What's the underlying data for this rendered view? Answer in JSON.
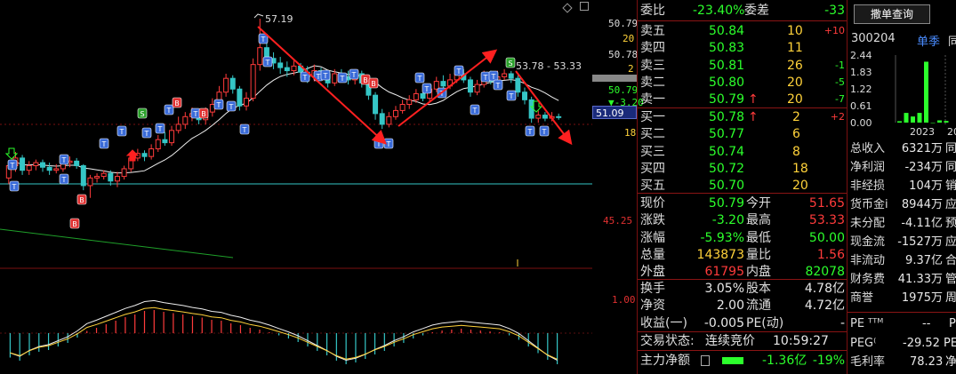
{
  "chart": {
    "high_label": "57.19",
    "range_label": "53.78 - 53.33",
    "current_price_tag": "51.09",
    "axis_labels": [
      "50.79",
      "20",
      "50.78",
      "2",
      "50.79",
      "▼-3.20",
      "20",
      "18",
      "45.25",
      "1.00"
    ],
    "marker_S": "S",
    "marker_B": "B",
    "marker_T": "T",
    "candles": [
      {
        "o": 46.8,
        "c": 47.6,
        "h": 47.9,
        "l": 46.4
      },
      {
        "o": 47.6,
        "c": 48.1,
        "h": 48.5,
        "l": 47.2
      },
      {
        "o": 48.1,
        "c": 47.3,
        "h": 48.3,
        "l": 47.0
      },
      {
        "o": 47.3,
        "c": 47.6,
        "h": 47.9,
        "l": 47.0
      },
      {
        "o": 47.6,
        "c": 47.8,
        "h": 48.0,
        "l": 47.3
      },
      {
        "o": 47.8,
        "c": 47.5,
        "h": 48.0,
        "l": 47.2
      },
      {
        "o": 47.5,
        "c": 47.3,
        "h": 47.8,
        "l": 47.0
      },
      {
        "o": 47.3,
        "c": 47.4,
        "h": 47.7,
        "l": 47.1
      },
      {
        "o": 47.4,
        "c": 47.8,
        "h": 48.1,
        "l": 47.2
      },
      {
        "o": 47.8,
        "c": 47.9,
        "h": 48.2,
        "l": 47.5
      },
      {
        "o": 47.9,
        "c": 47.6,
        "h": 48.1,
        "l": 47.4
      },
      {
        "o": 47.6,
        "c": 46.3,
        "h": 47.7,
        "l": 46.0
      },
      {
        "o": 46.3,
        "c": 46.8,
        "h": 47.0,
        "l": 45.5
      },
      {
        "o": 46.8,
        "c": 46.9,
        "h": 47.1,
        "l": 46.5
      },
      {
        "o": 46.9,
        "c": 47.1,
        "h": 47.3,
        "l": 46.7
      },
      {
        "o": 47.1,
        "c": 46.6,
        "h": 47.3,
        "l": 46.3
      },
      {
        "o": 46.6,
        "c": 46.9,
        "h": 47.2,
        "l": 46.2
      },
      {
        "o": 46.9,
        "c": 47.4,
        "h": 47.6,
        "l": 46.7
      },
      {
        "o": 47.4,
        "c": 48.1,
        "h": 48.4,
        "l": 47.2
      },
      {
        "o": 48.1,
        "c": 48.4,
        "h": 48.7,
        "l": 47.9
      },
      {
        "o": 48.4,
        "c": 48.2,
        "h": 48.6,
        "l": 47.9
      },
      {
        "o": 48.2,
        "c": 48.7,
        "h": 49.0,
        "l": 48.0
      },
      {
        "o": 48.7,
        "c": 49.3,
        "h": 49.6,
        "l": 48.5
      },
      {
        "o": 49.3,
        "c": 49.1,
        "h": 49.8,
        "l": 48.9
      },
      {
        "o": 49.1,
        "c": 49.9,
        "h": 50.2,
        "l": 48.9
      },
      {
        "o": 49.9,
        "c": 50.3,
        "h": 50.8,
        "l": 49.7
      },
      {
        "o": 50.3,
        "c": 50.8,
        "h": 51.1,
        "l": 50.0
      },
      {
        "o": 50.8,
        "c": 51.0,
        "h": 51.4,
        "l": 50.5
      },
      {
        "o": 51.0,
        "c": 50.6,
        "h": 51.2,
        "l": 50.3
      },
      {
        "o": 50.6,
        "c": 51.1,
        "h": 51.4,
        "l": 50.3
      },
      {
        "o": 51.1,
        "c": 51.6,
        "h": 52.0,
        "l": 50.8
      },
      {
        "o": 51.6,
        "c": 52.4,
        "h": 52.8,
        "l": 51.3
      },
      {
        "o": 52.4,
        "c": 53.3,
        "h": 53.6,
        "l": 52.1
      },
      {
        "o": 53.3,
        "c": 52.6,
        "h": 53.5,
        "l": 52.3
      },
      {
        "o": 52.6,
        "c": 51.5,
        "h": 52.8,
        "l": 51.2
      },
      {
        "o": 51.5,
        "c": 52.0,
        "h": 52.4,
        "l": 51.2
      },
      {
        "o": 52.0,
        "c": 54.2,
        "h": 54.6,
        "l": 51.8
      },
      {
        "o": 54.2,
        "c": 55.3,
        "h": 57.19,
        "l": 53.8
      },
      {
        "o": 55.3,
        "c": 54.6,
        "h": 55.8,
        "l": 54.3
      },
      {
        "o": 54.6,
        "c": 54.3,
        "h": 55.0,
        "l": 53.9
      },
      {
        "o": 54.3,
        "c": 54.0,
        "h": 54.7,
        "l": 53.6
      },
      {
        "o": 54.0,
        "c": 53.8,
        "h": 54.4,
        "l": 53.4
      },
      {
        "o": 53.8,
        "c": 54.1,
        "h": 54.5,
        "l": 53.5
      },
      {
        "o": 54.1,
        "c": 53.7,
        "h": 54.3,
        "l": 53.3
      },
      {
        "o": 53.7,
        "c": 53.4,
        "h": 54.1,
        "l": 53.0
      },
      {
        "o": 53.4,
        "c": 53.8,
        "h": 54.2,
        "l": 53.1
      },
      {
        "o": 53.8,
        "c": 53.6,
        "h": 54.0,
        "l": 53.2
      },
      {
        "o": 53.6,
        "c": 53.0,
        "h": 53.8,
        "l": 52.7
      },
      {
        "o": 53.0,
        "c": 53.6,
        "h": 53.9,
        "l": 52.8
      },
      {
        "o": 53.6,
        "c": 53.4,
        "h": 53.9,
        "l": 53.1
      },
      {
        "o": 53.4,
        "c": 53.2,
        "h": 53.8,
        "l": 52.9
      },
      {
        "o": 53.2,
        "c": 53.6,
        "h": 53.9,
        "l": 52.9
      },
      {
        "o": 53.6,
        "c": 53.0,
        "h": 53.8,
        "l": 52.7
      },
      {
        "o": 53.0,
        "c": 52.2,
        "h": 53.2,
        "l": 51.9
      },
      {
        "o": 52.2,
        "c": 51.0,
        "h": 52.4,
        "l": 50.6
      },
      {
        "o": 51.0,
        "c": 50.3,
        "h": 51.3,
        "l": 50.0
      },
      {
        "o": 50.3,
        "c": 50.8,
        "h": 51.1,
        "l": 50.1
      },
      {
        "o": 50.8,
        "c": 51.2,
        "h": 51.5,
        "l": 50.6
      },
      {
        "o": 51.2,
        "c": 51.6,
        "h": 51.9,
        "l": 51.0
      },
      {
        "o": 51.6,
        "c": 51.9,
        "h": 52.2,
        "l": 51.3
      },
      {
        "o": 51.9,
        "c": 52.3,
        "h": 52.6,
        "l": 51.7
      },
      {
        "o": 52.3,
        "c": 52.0,
        "h": 52.7,
        "l": 51.8
      },
      {
        "o": 52.0,
        "c": 52.6,
        "h": 52.9,
        "l": 51.8
      },
      {
        "o": 52.6,
        "c": 53.1,
        "h": 53.4,
        "l": 52.4
      },
      {
        "o": 53.1,
        "c": 52.8,
        "h": 53.5,
        "l": 52.5
      },
      {
        "o": 52.8,
        "c": 53.2,
        "h": 53.6,
        "l": 52.6
      },
      {
        "o": 53.2,
        "c": 53.6,
        "h": 53.9,
        "l": 53.0
      },
      {
        "o": 53.6,
        "c": 53.2,
        "h": 53.9,
        "l": 53.0
      },
      {
        "o": 53.2,
        "c": 52.4,
        "h": 53.4,
        "l": 52.1
      },
      {
        "o": 52.4,
        "c": 52.9,
        "h": 53.2,
        "l": 52.2
      },
      {
        "o": 52.9,
        "c": 53.5,
        "h": 53.8,
        "l": 52.7
      },
      {
        "o": 53.5,
        "c": 53.1,
        "h": 53.8,
        "l": 52.9
      },
      {
        "o": 53.1,
        "c": 53.4,
        "h": 53.8,
        "l": 52.9
      },
      {
        "o": 53.4,
        "c": 53.6,
        "h": 53.9,
        "l": 53.2
      },
      {
        "o": 53.6,
        "c": 53.3,
        "h": 53.78,
        "l": 53.0
      },
      {
        "o": 53.3,
        "c": 52.4,
        "h": 53.5,
        "l": 52.1
      },
      {
        "o": 52.4,
        "c": 51.9,
        "h": 52.7,
        "l": 51.6
      },
      {
        "o": 51.9,
        "c": 50.7,
        "h": 52.1,
        "l": 50.4
      },
      {
        "o": 50.7,
        "c": 50.9,
        "h": 51.2,
        "l": 50.4
      },
      {
        "o": 50.9,
        "c": 50.7,
        "h": 51.1,
        "l": 50.5
      },
      {
        "o": 50.7,
        "c": 50.8,
        "h": 51.1,
        "l": 50.5
      },
      {
        "o": 50.8,
        "c": 50.79,
        "h": 51.0,
        "l": 50.6
      }
    ],
    "macd": [
      -0.55,
      -0.62,
      -0.5,
      -0.42,
      -0.38,
      -0.3,
      -0.22,
      -0.1,
      0.05,
      0.12,
      0.2,
      0.28,
      0.36,
      0.42,
      0.5,
      0.52,
      0.48,
      0.45,
      0.42,
      0.38,
      0.35,
      0.3,
      0.28,
      0.22,
      0.18,
      0.12,
      0.08,
      0.02,
      -0.05,
      -0.12,
      -0.2,
      -0.3,
      -0.4,
      -0.5,
      -0.62,
      -0.7,
      -0.66,
      -0.58,
      -0.48,
      -0.4,
      -0.3,
      -0.22,
      -0.12,
      -0.05,
      0.02,
      0.06,
      0.08,
      0.1,
      0.08,
      0.06,
      0.04,
      0.02,
      -0.05,
      -0.15,
      -0.3,
      -0.45,
      -0.6,
      -0.7
    ]
  },
  "quote": {
    "wei_bi_label": "委比",
    "wei_bi_value": "-23.40%",
    "wei_cha_label": "委差",
    "wei_cha_value": "-33",
    "asks": [
      {
        "label": "卖五",
        "price": "50.84",
        "vol": "10",
        "chg": "+10"
      },
      {
        "label": "卖四",
        "price": "50.83",
        "vol": "11",
        "chg": ""
      },
      {
        "label": "卖三",
        "price": "50.81",
        "vol": "26",
        "chg": "-1"
      },
      {
        "label": "卖二",
        "price": "50.80",
        "vol": "20",
        "chg": "-5"
      },
      {
        "label": "卖一",
        "price": "50.79",
        "vol": "20",
        "chg": "-7",
        "arrow": "↑"
      }
    ],
    "bids": [
      {
        "label": "买一",
        "price": "50.78",
        "vol": "2",
        "chg": "+2",
        "arrow": "↑"
      },
      {
        "label": "买二",
        "price": "50.77",
        "vol": "6",
        "chg": ""
      },
      {
        "label": "买三",
        "price": "50.74",
        "vol": "8",
        "chg": ""
      },
      {
        "label": "买四",
        "price": "50.72",
        "vol": "18",
        "chg": ""
      },
      {
        "label": "买五",
        "price": "50.70",
        "vol": "20",
        "chg": ""
      }
    ],
    "stats": [
      {
        "l1": "现价",
        "v1": "50.79",
        "c1": "green",
        "l2": "今开",
        "v2": "51.65",
        "c2": "red"
      },
      {
        "l1": "涨跌",
        "v1": "-3.20",
        "c1": "green",
        "l2": "最高",
        "v2": "53.33",
        "c2": "red"
      },
      {
        "l1": "涨幅",
        "v1": "-5.93%",
        "c1": "green",
        "l2": "最低",
        "v2": "50.00",
        "c2": "green"
      },
      {
        "l1": "总量",
        "v1": "143873",
        "c1": "yellow",
        "l2": "量比",
        "v2": "1.56",
        "c2": "red"
      },
      {
        "l1": "外盘",
        "v1": "61795",
        "c1": "red",
        "l2": "内盘",
        "v2": "82078",
        "c2": "green"
      }
    ],
    "stats2": [
      {
        "l1": "换手",
        "v1": "3.05%",
        "l2": "股本",
        "v2": "4.78亿"
      },
      {
        "l1": "净资",
        "v1": "2.00",
        "l2": "流通",
        "v2": "4.72亿"
      },
      {
        "l1": "收益(一)",
        "v1": "-0.005",
        "l2": "PE(动)",
        "v2": "-"
      }
    ],
    "trade_status_label": "交易状态:",
    "trade_status_value": "连续竞价",
    "trade_time": "10:59:27",
    "main_net_label": "主力净额",
    "main_net_value": "-1.36亿",
    "main_net_pct": "-19%"
  },
  "finance": {
    "button_label": "撒单查询",
    "stock_code": "300204",
    "period_label": "单季",
    "period_label2": "同",
    "y_ticks": [
      "2.44",
      "1.83",
      "1.22",
      "0.61",
      "0.00"
    ],
    "bars": [
      0.05,
      0.35,
      0.22,
      0.35,
      2.2,
      0.0,
      0.08,
      0.06
    ],
    "years": [
      "2023",
      "20"
    ],
    "rows": [
      {
        "label": "总收入",
        "value": "6321万",
        "extra": "同"
      },
      {
        "label": "净利润",
        "value": "-234万",
        "extra": "同"
      },
      {
        "label": "非经损",
        "value": "104万",
        "extra": "销"
      },
      {
        "label": "货币金i",
        "value": "8944万",
        "extra": "应"
      },
      {
        "label": "未分配",
        "value": "-4.11亿",
        "extra": "预"
      },
      {
        "label": "现金流",
        "value": "-1527万",
        "extra": "应"
      },
      {
        "label": "非流动",
        "value": "9.37亿",
        "extra": "合"
      },
      {
        "label": "财务费",
        "value": "41.33万",
        "extra": "管"
      },
      {
        "label": "商誉",
        "value": "1975万",
        "extra": "周"
      }
    ],
    "pe_label": "PE ᵀᵀᴹ",
    "pe_value": "--",
    "pe_extra": "P",
    "peg_label": "PEG⁽",
    "peg_value": "-29.52",
    "peg_extra": "PE",
    "gross_label": "毛利率",
    "gross_value": "78.23",
    "gross_extra": "净"
  }
}
